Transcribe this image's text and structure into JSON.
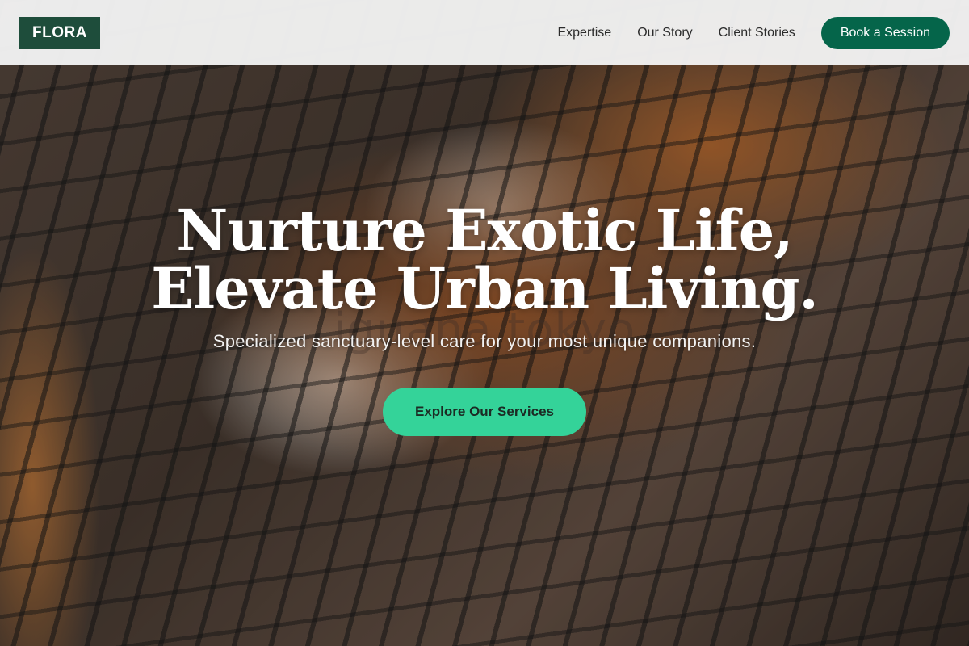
{
  "header": {
    "logo": "FLORA",
    "nav": [
      {
        "label": "Expertise"
      },
      {
        "label": "Our Story"
      },
      {
        "label": "Client Stories"
      }
    ],
    "cta_label": "Book a Session"
  },
  "hero": {
    "title_line1": "Nurture Exotic Life,",
    "title_line2": "Elevate Urban Living.",
    "background_text": "iguana tokyo",
    "subtitle": "Specialized sanctuary-level care for your most unique companions.",
    "button_label": "Explore Our Services"
  },
  "colors": {
    "logo_bg": "#1e4d3b",
    "cta_bg": "#05654a",
    "hero_button_bg": "#34d399"
  }
}
